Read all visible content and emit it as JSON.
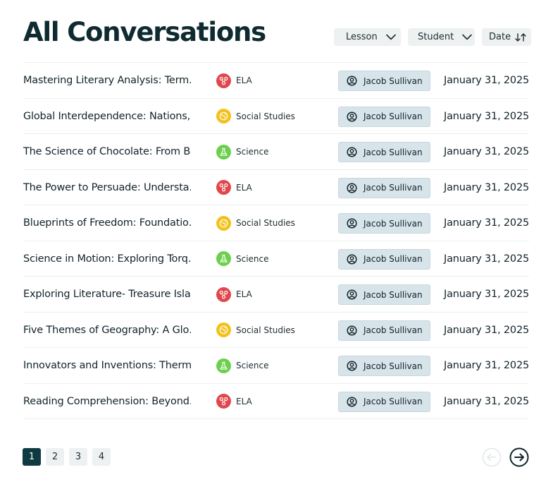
{
  "page_title": "All Conversations",
  "filters": {
    "lesson_label": "Lesson",
    "student_label": "Student",
    "date_label": "Date"
  },
  "subject_colors": {
    "ELA": "#e0474c",
    "Social Studies": "#f2c21b",
    "Science": "#6ccf4e"
  },
  "conversations": [
    {
      "title": "Mastering Literary Analysis: Term…",
      "subject": "ELA",
      "subject_icon": "molecule-icon",
      "student": "Jacob Sullivan",
      "date": "January 31, 2025"
    },
    {
      "title": "Global Interdependence: Nations,…",
      "subject": "Social Studies",
      "subject_icon": "globe-icon",
      "student": "Jacob Sullivan",
      "date": "January 31, 2025"
    },
    {
      "title": "The Science of Chocolate: From B…",
      "subject": "Science",
      "subject_icon": "flask-icon",
      "student": "Jacob Sullivan",
      "date": "January 31, 2025"
    },
    {
      "title": "The Power to Persuade: Understa…",
      "subject": "ELA",
      "subject_icon": "molecule-icon",
      "student": "Jacob Sullivan",
      "date": "January 31, 2025"
    },
    {
      "title": "Blueprints of Freedom: Foundatio…",
      "subject": "Social Studies",
      "subject_icon": "globe-icon",
      "student": "Jacob Sullivan",
      "date": "January 31, 2025"
    },
    {
      "title": "Science in Motion: Exploring Torq…",
      "subject": "Science",
      "subject_icon": "flask-icon",
      "student": "Jacob Sullivan",
      "date": "January 31, 2025"
    },
    {
      "title": "Exploring Literature- Treasure Isla…",
      "subject": "ELA",
      "subject_icon": "molecule-icon",
      "student": "Jacob Sullivan",
      "date": "January 31, 2025"
    },
    {
      "title": "Five Themes of Geography: A Glo…",
      "subject": "Social Studies",
      "subject_icon": "globe-icon",
      "student": "Jacob Sullivan",
      "date": "January 31, 2025"
    },
    {
      "title": "Innovators and Inventions: Therm…",
      "subject": "Science",
      "subject_icon": "flask-icon",
      "student": "Jacob Sullivan",
      "date": "January 31, 2025"
    },
    {
      "title": "Reading Comprehension: Beyond…",
      "subject": "ELA",
      "subject_icon": "molecule-icon",
      "student": "Jacob Sullivan",
      "date": "January 31, 2025"
    }
  ],
  "pagination": {
    "pages": [
      "1",
      "2",
      "3",
      "4"
    ],
    "current": "1"
  }
}
